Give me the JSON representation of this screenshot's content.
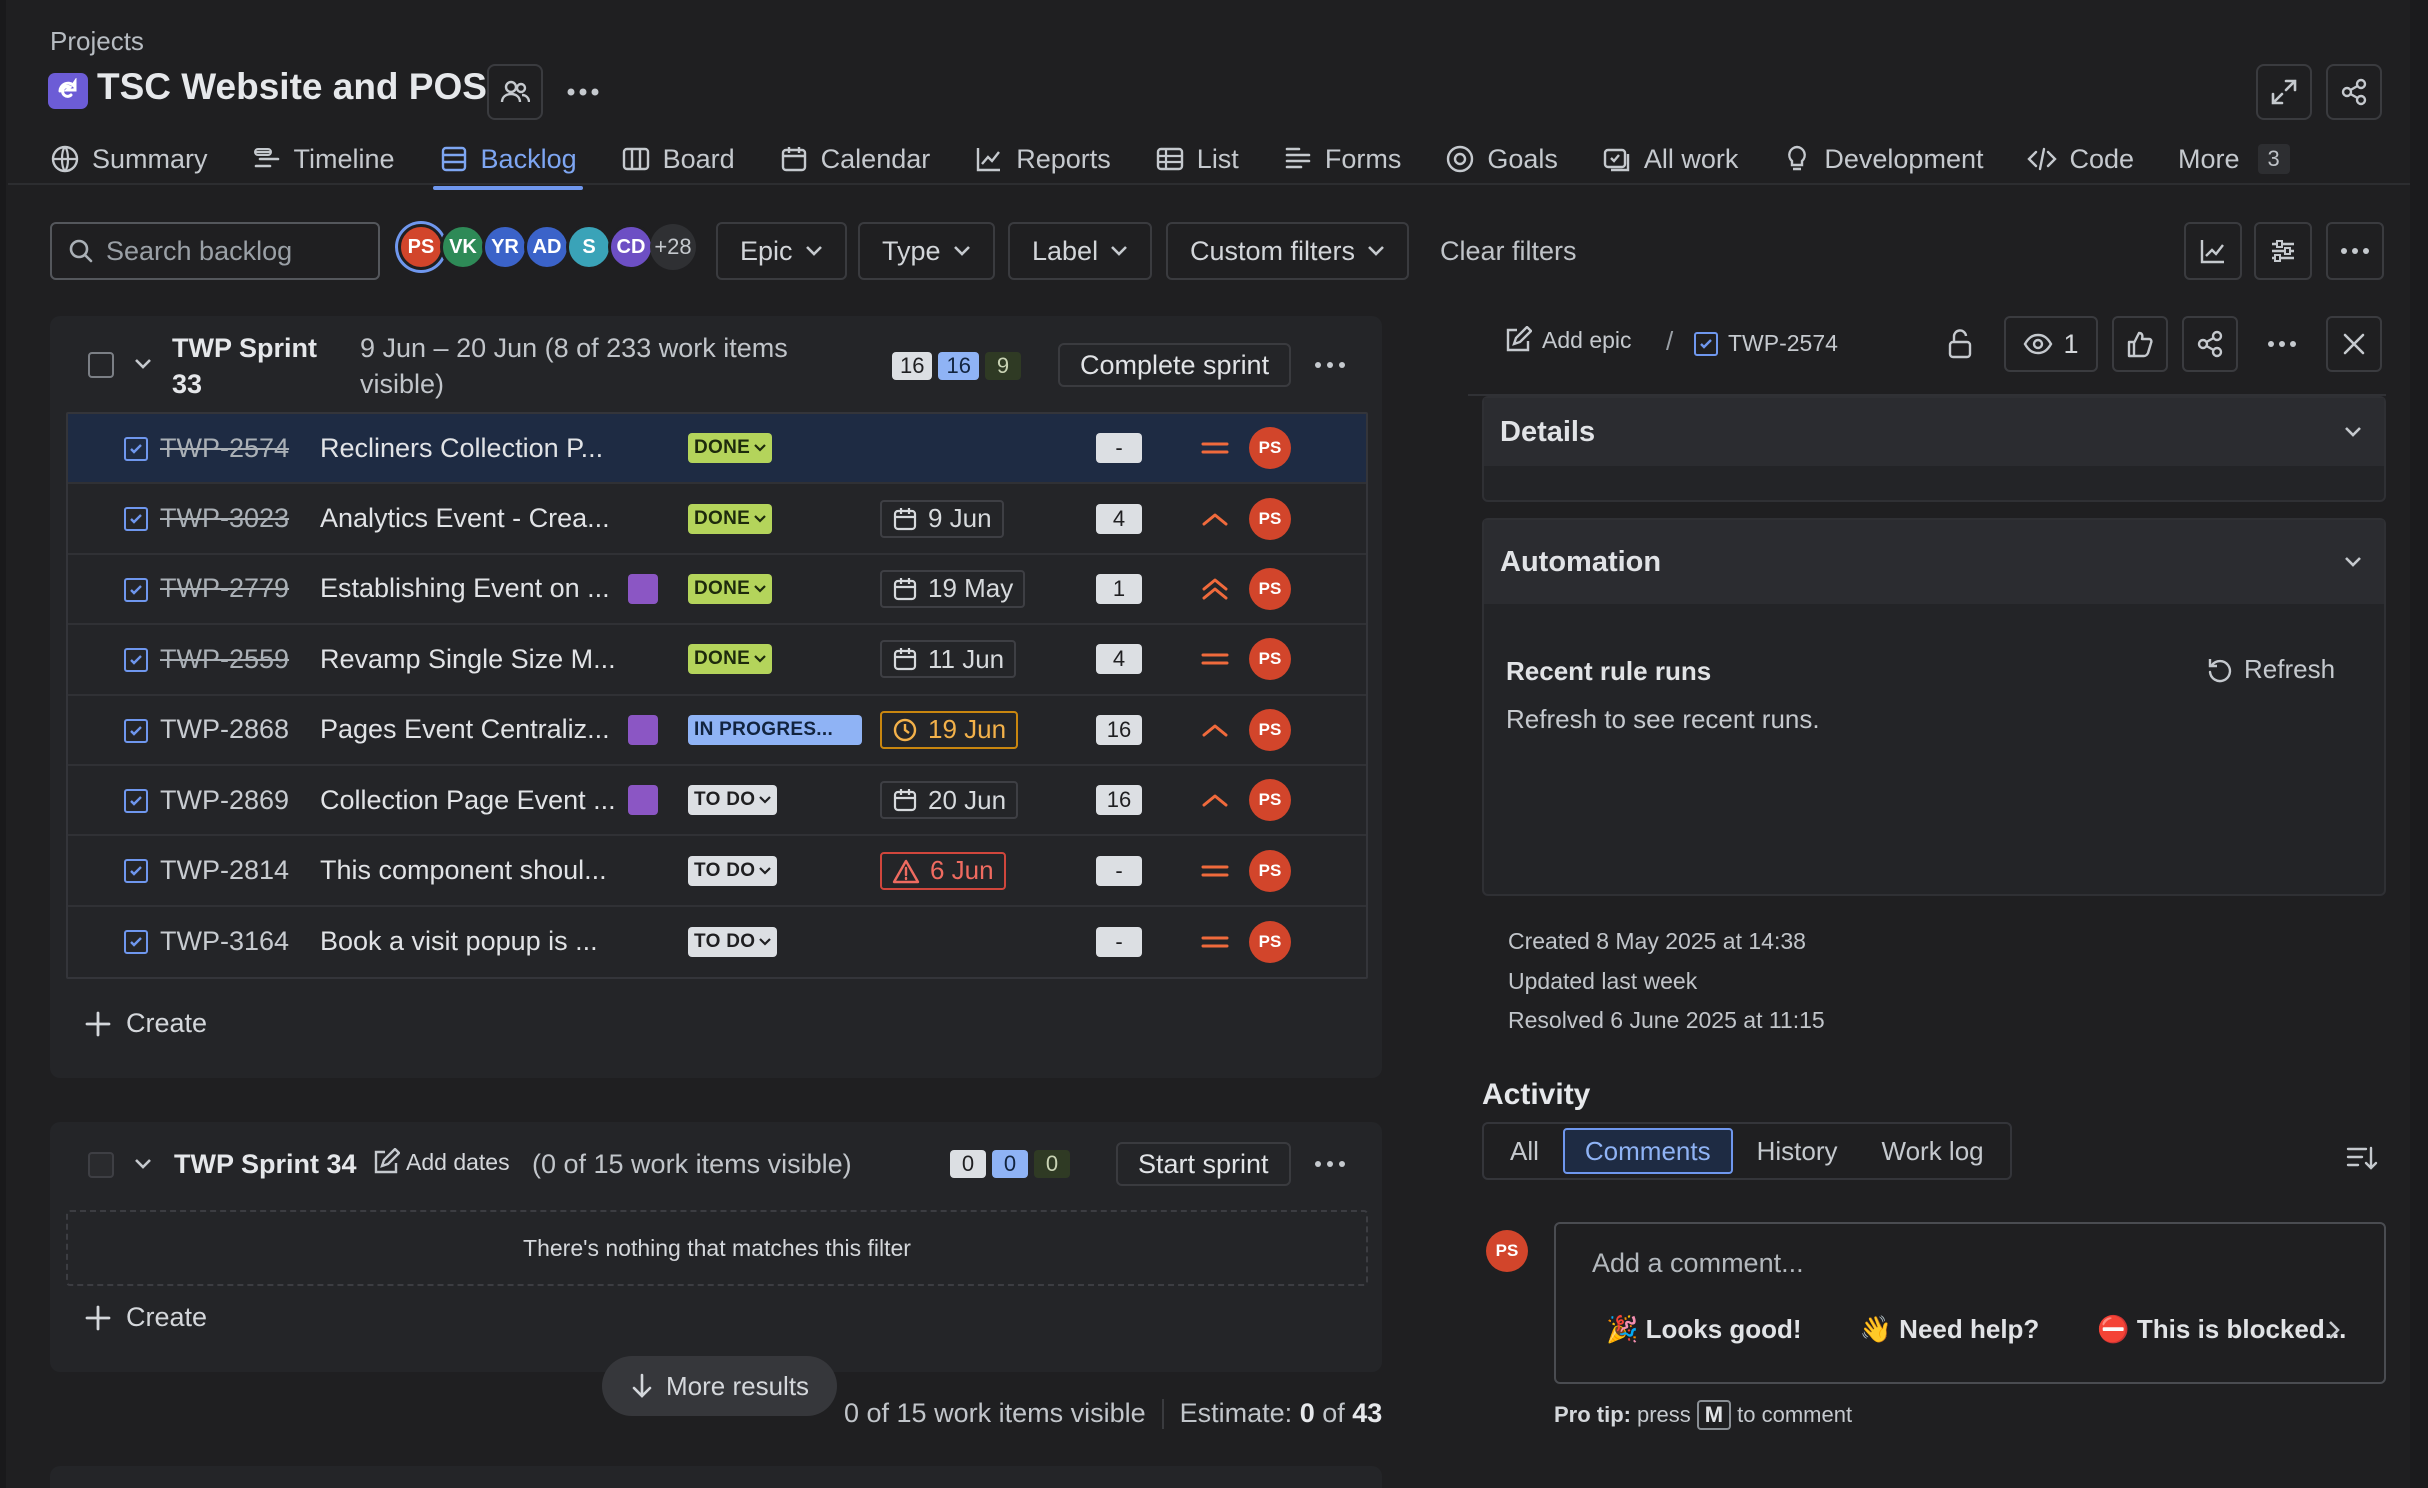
{
  "header": {
    "breadcrumb": "Projects",
    "project_title": "TSC Website and POS"
  },
  "tabs": [
    {
      "label": "Summary",
      "icon": "globe-icon"
    },
    {
      "label": "Timeline",
      "icon": "timeline-icon"
    },
    {
      "label": "Backlog",
      "icon": "backlog-icon",
      "active": true
    },
    {
      "label": "Board",
      "icon": "board-icon"
    },
    {
      "label": "Calendar",
      "icon": "calendar-icon"
    },
    {
      "label": "Reports",
      "icon": "reports-icon"
    },
    {
      "label": "List",
      "icon": "list-icon"
    },
    {
      "label": "Forms",
      "icon": "forms-icon"
    },
    {
      "label": "Goals",
      "icon": "goals-icon"
    },
    {
      "label": "All work",
      "icon": "all-work-icon"
    },
    {
      "label": "Development",
      "icon": "development-icon"
    },
    {
      "label": "Code",
      "icon": "code-icon"
    },
    {
      "label": "More",
      "icon": "",
      "count": "3"
    }
  ],
  "toolbar": {
    "search_placeholder": "Search backlog",
    "avatars": [
      {
        "initials": "PS",
        "color": "#d2452b"
      },
      {
        "initials": "VK",
        "color": "#2e8a57"
      },
      {
        "initials": "YR",
        "color": "#3b63c9"
      },
      {
        "initials": "AD",
        "color": "#3b63c9"
      },
      {
        "initials": "S",
        "color": "#3aa3b8"
      },
      {
        "initials": "CD",
        "color": "#6d4fc4"
      }
    ],
    "avatars_more": "+28",
    "filters": [
      "Epic",
      "Type",
      "Label",
      "Custom filters"
    ],
    "clear_filters": "Clear filters"
  },
  "sprint1": {
    "name_line1": "TWP Sprint",
    "name_line2": "33",
    "meta_line1": "9 Jun – 20 Jun (8 of 233 work items",
    "meta_line2": "visible)",
    "counts": [
      "16",
      "16",
      "9"
    ],
    "action": "Complete sprint",
    "create": "Create",
    "items": [
      {
        "key": "TWP-2574",
        "summary": "Recliners Collection P...",
        "status": "DONE",
        "status_type": "done",
        "epic": false,
        "due": "",
        "due_type": "",
        "estimate": "-",
        "priority": "medium",
        "assignee": "PS",
        "strike": true,
        "selected": true
      },
      {
        "key": "TWP-3023",
        "summary": "Analytics Event - Crea...",
        "status": "DONE",
        "status_type": "done",
        "epic": false,
        "due": "9 Jun",
        "due_type": "normal",
        "estimate": "4",
        "priority": "high",
        "assignee": "PS",
        "strike": true,
        "selected": false
      },
      {
        "key": "TWP-2779",
        "summary": "Establishing Event on ...",
        "status": "DONE",
        "status_type": "done",
        "epic": true,
        "due": "19 May",
        "due_type": "normal",
        "estimate": "1",
        "priority": "highest",
        "assignee": "PS",
        "strike": true,
        "selected": false
      },
      {
        "key": "TWP-2559",
        "summary": "Revamp Single Size M...",
        "status": "DONE",
        "status_type": "done",
        "epic": false,
        "due": "11 Jun",
        "due_type": "normal",
        "estimate": "4",
        "priority": "medium",
        "assignee": "PS",
        "strike": true,
        "selected": false
      },
      {
        "key": "TWP-2868",
        "summary": "Pages Event Centraliz...",
        "status": "IN PROGRES...",
        "status_type": "prog",
        "epic": true,
        "due": "19 Jun",
        "due_type": "warn",
        "estimate": "16",
        "priority": "high",
        "assignee": "PS",
        "strike": false,
        "selected": false
      },
      {
        "key": "TWP-2869",
        "summary": "Collection Page Event ...",
        "status": "TO DO",
        "status_type": "todo",
        "epic": true,
        "due": "20 Jun",
        "due_type": "normal",
        "estimate": "16",
        "priority": "high",
        "assignee": "PS",
        "strike": false,
        "selected": false
      },
      {
        "key": "TWP-2814",
        "summary": "This component shoul...",
        "status": "TO DO",
        "status_type": "todo",
        "epic": false,
        "due": "6 Jun",
        "due_type": "over",
        "estimate": "-",
        "priority": "medium",
        "assignee": "PS",
        "strike": false,
        "selected": false
      },
      {
        "key": "TWP-3164",
        "summary": "Book a visit popup is ...",
        "status": "TO DO",
        "status_type": "todo",
        "epic": false,
        "due": "",
        "due_type": "",
        "estimate": "-",
        "priority": "medium",
        "assignee": "PS",
        "strike": false,
        "selected": false
      }
    ]
  },
  "sprint2": {
    "name": "TWP Sprint 34",
    "add_dates": "Add dates",
    "meta": "(0 of 15 work items visible)",
    "counts": [
      "0",
      "0",
      "0"
    ],
    "action": "Start sprint",
    "empty": "There's nothing that matches this filter",
    "create": "Create"
  },
  "footer": {
    "more_results": "More results",
    "visible": "0 of 15 work items visible",
    "estimate_label": "Estimate:",
    "estimate_value": "0",
    "estimate_of": "of",
    "estimate_total": "43"
  },
  "detail": {
    "add_epic": "Add epic",
    "issue_key": "TWP-2574",
    "watchers": "1",
    "details_title": "Details",
    "automation_title": "Automation",
    "recent_rule_runs": "Recent rule runs",
    "refresh": "Refresh",
    "refresh_hint": "Refresh to see recent runs.",
    "created": "Created 8 May 2025 at 14:38",
    "updated": "Updated last week",
    "resolved": "Resolved 6 June 2025 at 11:15",
    "activity_title": "Activity",
    "activity_tabs": [
      "All",
      "Comments",
      "History",
      "Work log"
    ],
    "activity_active": "Comments",
    "commenter": "PS",
    "comment_placeholder": "Add a comment...",
    "quick_replies": [
      "🎉 Looks good!",
      "👋 Need help?",
      "⛔ This is blocked..."
    ],
    "pro_tip_label": "Pro tip:",
    "pro_tip_press": "press",
    "pro_tip_key": "M",
    "pro_tip_end": "to comment"
  },
  "colors": {
    "accent": "#6f97ee",
    "done": "#b4d45b",
    "in_progress": "#8fb3f5",
    "priority": "#f06a3c",
    "assignee": "#d2452b"
  }
}
